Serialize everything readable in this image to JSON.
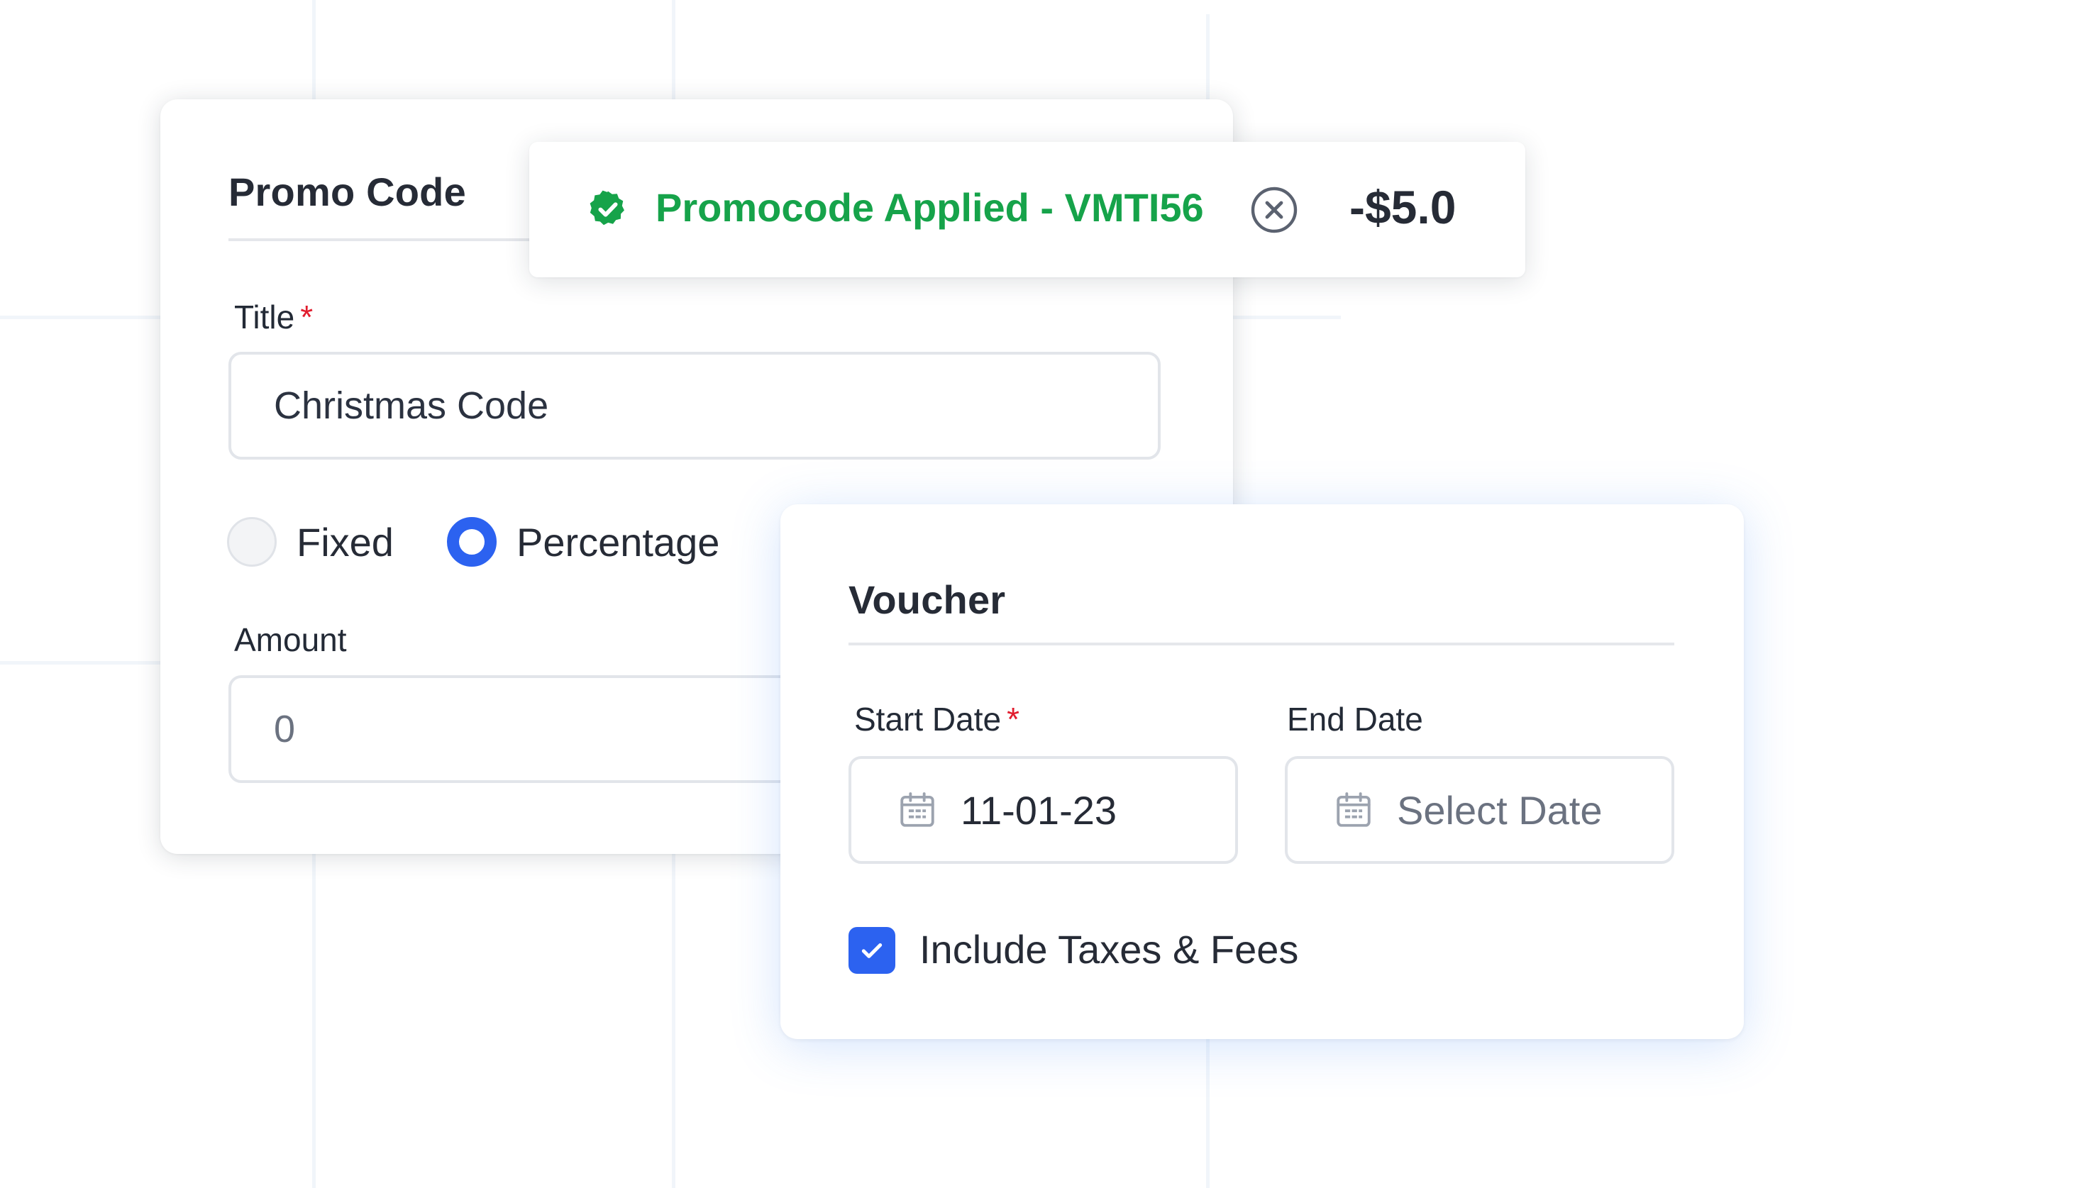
{
  "promo": {
    "title": "Promo Code",
    "title_field": {
      "label": "Title",
      "required_mark": "*",
      "value": "Christmas Code"
    },
    "discount_type": {
      "options": [
        "Fixed",
        "Percentage"
      ],
      "selected": "Percentage"
    },
    "amount_field": {
      "label": "Amount",
      "value": "0"
    }
  },
  "applied": {
    "message": "Promocode Applied - VMTI56",
    "discount": "-$5.0"
  },
  "voucher": {
    "title": "Voucher",
    "start_date": {
      "label": "Start Date",
      "required_mark": "*",
      "value": "11-01-23"
    },
    "end_date": {
      "label": "End Date",
      "placeholder": "Select Date"
    },
    "include_taxes": {
      "label": "Include Taxes & Fees",
      "checked": true
    }
  },
  "colors": {
    "accent": "#2c62f0",
    "success": "#16a34a",
    "required": "#e11d2e"
  }
}
